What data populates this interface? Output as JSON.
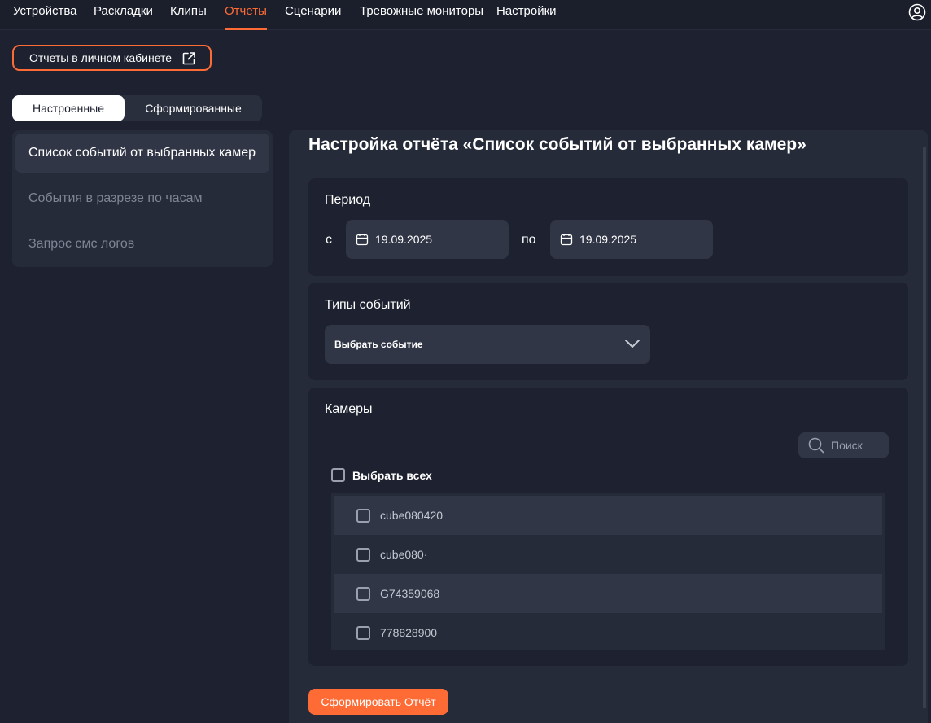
{
  "nav": {
    "items": [
      {
        "label": "Устройства"
      },
      {
        "label": "Раскладки"
      },
      {
        "label": "Клипы"
      },
      {
        "label": "Отчеты"
      },
      {
        "label": "Сценарии"
      },
      {
        "label": "Тревожные мониторы"
      },
      {
        "label": "Настройки"
      }
    ],
    "active": "Отчеты",
    "user_icon": "user-circle-icon"
  },
  "lk_button": {
    "label": "Отчеты в личном кабинете",
    "icon": "external-link-icon"
  },
  "tabs": {
    "configured": "Настроенные",
    "generated": "Сформированные",
    "active": "configured"
  },
  "reports": [
    {
      "label": "Список событий от выбранных камер",
      "selected": true
    },
    {
      "label": "События в разрезе по часам",
      "selected": false
    },
    {
      "label": "Запрос смс логов",
      "selected": false
    }
  ],
  "main": {
    "title": "Настройка отчёта «Список событий от выбранных камер»",
    "period": {
      "title": "Период",
      "from_label": "с",
      "from_value": "19.09.2025",
      "to_label": "по",
      "to_value": "19.09.2025"
    },
    "event_types": {
      "title": "Типы событий",
      "select_value": "Выбрать событие"
    },
    "cameras": {
      "title": "Камеры",
      "search_placeholder": "Поиск",
      "select_all": "Выбрать всех",
      "rows": [
        {
          "name": "cube080420"
        },
        {
          "name": "cube080·"
        },
        {
          "name": "G74359068"
        },
        {
          "name": "778828900"
        }
      ]
    },
    "submit": "Сформировать Отчёт"
  },
  "colors": {
    "accent": "#ff6b35",
    "background": "#1e2230",
    "panel": "#262b39",
    "input": "#313646"
  }
}
